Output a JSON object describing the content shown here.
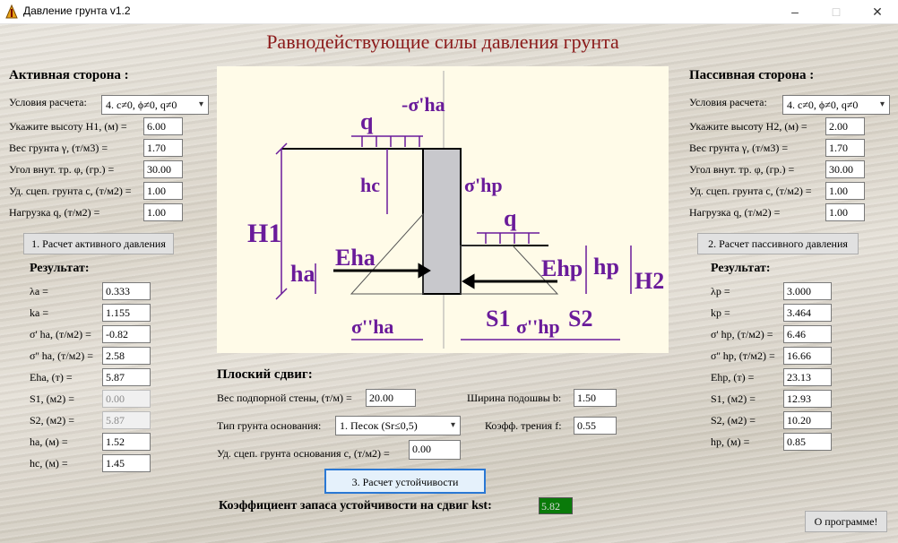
{
  "window": {
    "title": "Давление грунта v1.2",
    "minimize": "–",
    "maximize": "□",
    "close": "✕"
  },
  "main_title": "Равнодействующие силы давления грунта",
  "active": {
    "heading": "Активная сторона :",
    "condition_label": "Условия расчета:",
    "condition_value": "4. c≠0, ϕ≠0, q≠0",
    "inputs": [
      {
        "label": "Укажите высоту H1, (м) =",
        "value": "6.00"
      },
      {
        "label": "Вес грунта γ, (т/м3) =",
        "value": "1.70"
      },
      {
        "label": "Угол внут. тр. φ, (гр.) =",
        "value": "30.00"
      },
      {
        "label": "Уд. сцеп. грунта с, (т/м2) =",
        "value": "1.00"
      },
      {
        "label": "Нагрузка q, (т/м2) =",
        "value": "1.00"
      }
    ],
    "calc_button": "1. Расчет активного давления",
    "results_heading": "Результат:",
    "results": [
      {
        "label": "λa =",
        "value": "0.333",
        "disabled": false
      },
      {
        "label": "ka =",
        "value": "1.155",
        "disabled": false
      },
      {
        "label": "σ' ha, (т/м2) =",
        "value": "-0.82",
        "disabled": false
      },
      {
        "label": "σ'' ha, (т/м2) =",
        "value": "2.58",
        "disabled": false
      },
      {
        "label": "Eha, (т) =",
        "value": "5.87",
        "disabled": false
      },
      {
        "label": "S1, (м2) =",
        "value": "0.00",
        "disabled": true
      },
      {
        "label": "S2, (м2) =",
        "value": "5.87",
        "disabled": true
      },
      {
        "label": "ha, (м) =",
        "value": "1.52",
        "disabled": false
      },
      {
        "label": "hc, (м) =",
        "value": "1.45",
        "disabled": false
      }
    ]
  },
  "passive": {
    "heading": "Пассивная сторона :",
    "condition_label": "Условия расчета:",
    "condition_value": "4. c≠0, ϕ≠0, q≠0",
    "inputs": [
      {
        "label": "Укажите высоту H2, (м) =",
        "value": "2.00"
      },
      {
        "label": "Вес грунта γ, (т/м3) =",
        "value": "1.70"
      },
      {
        "label": "Угол внут. тр. φ, (гр.) =",
        "value": "30.00"
      },
      {
        "label": "Уд. сцеп. грунта с, (т/м2) =",
        "value": "1.00"
      },
      {
        "label": "Нагрузка q, (т/м2) =",
        "value": "1.00"
      }
    ],
    "calc_button": "2. Расчет пассивного давления",
    "results_heading": "Результат:",
    "results": [
      {
        "label": "λp =",
        "value": "3.000"
      },
      {
        "label": "kp =",
        "value": "3.464"
      },
      {
        "label": "σ' hp, (т/м2) =",
        "value": "6.46"
      },
      {
        "label": "σ'' hp, (т/м2) =",
        "value": "16.66"
      },
      {
        "label": "Ehp, (т) =",
        "value": "23.13"
      },
      {
        "label": "S1, (м2) =",
        "value": "12.93"
      },
      {
        "label": "S2, (м2) =",
        "value": "10.20"
      },
      {
        "label": "hp, (м) =",
        "value": "0.85"
      }
    ]
  },
  "shear": {
    "heading": "Плоский сдвиг:",
    "wall_weight_label": "Вес подпорной стены, (т/м) =",
    "wall_weight_value": "20.00",
    "base_width_label": "Ширина подошвы b:",
    "base_width_value": "1.50",
    "soil_type_label": "Тип грунта основания:",
    "soil_type_value": "1. Песок (Sr≤0,5)",
    "friction_label": "Коэфф. трения f:",
    "friction_value": "0.55",
    "cohesion_label": "Уд. сцеп. грунта основания с, (т/м2) =",
    "cohesion_value": "0.00",
    "calc_button": "3. Расчет устойчивости",
    "kst_label": "Коэффициент запаса устойчивости на сдвиг kst:",
    "kst_value": "5.82"
  },
  "about_button": "О программе!",
  "diagram": {
    "q_left": "q",
    "q_right": "q",
    "sigma_top": "-σ'ha",
    "sigma_hp_top": "σ'hp",
    "hc": "hc",
    "H1": "H1",
    "ha": "ha",
    "Eha": "Eha",
    "Ehp": "Ehp",
    "hp": "hp",
    "H2": "H2",
    "sigma_ha_bottom": "σ''ha",
    "S1": "S1",
    "sigma_hp_bottom": "σ''hp",
    "S2": "S2"
  },
  "colors": {
    "title": "#8b1a1a",
    "diagram_ink": "#6a1b9a",
    "kst_bg": "#0a7a0a",
    "diagram_bg": "#fffbe8"
  }
}
